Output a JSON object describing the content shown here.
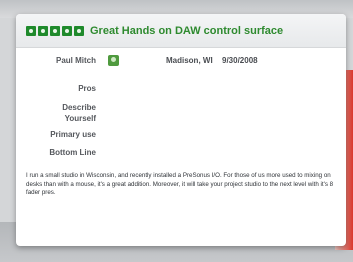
{
  "review": {
    "rating_stars": 5,
    "title": "Great Hands on DAW control surface",
    "author": "Paul Mitch",
    "location": "Madison, WI",
    "date": "9/30/2008",
    "fields": {
      "pros_label": "Pros",
      "describe_label": "Describe Yourself",
      "primary_use_label": "Primary use",
      "bottom_line_label": "Bottom Line"
    },
    "body": "I run a small studio in Wisconsin, and recently installed a PreSonus I/O. For those of us more used to mixing on desks than with a mouse, it's a great addition. Moreover, it will take your project studio to the next level with it's 8 fader pres."
  },
  "colors": {
    "accent_green": "#2e8a2f",
    "star_green": "#1f8a2c",
    "link_red": "#cf4a5b"
  },
  "icons": {
    "rating": "star-icon",
    "user": "user-icon"
  }
}
